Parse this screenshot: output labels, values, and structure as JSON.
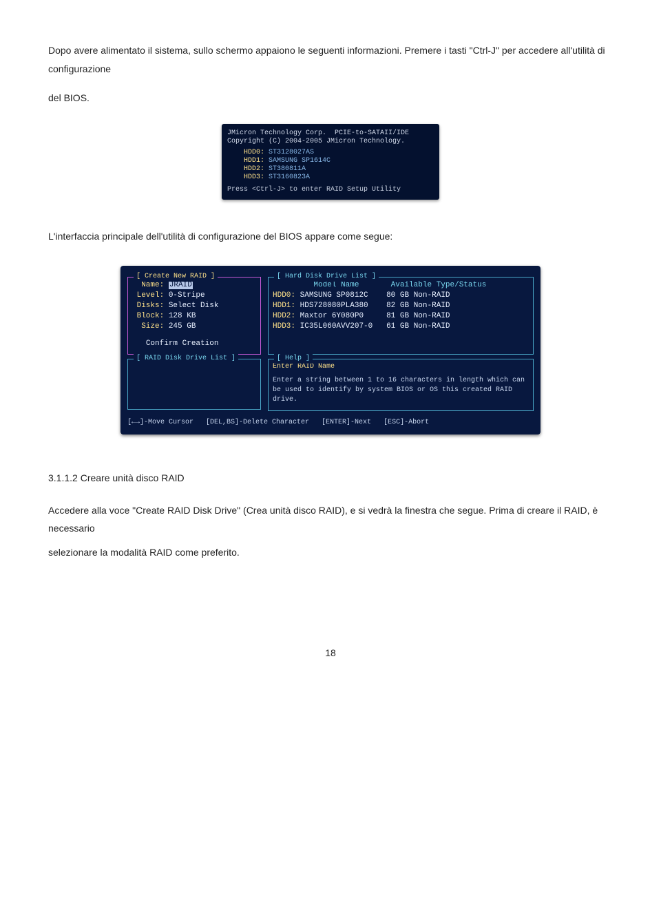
{
  "intro": {
    "line1": "Dopo avere alimentato il sistema, sullo schermo appaiono le seguenti informazioni. Premere i tasti \"Ctrl-J\" per accedere all'utilità di configurazione",
    "line2": "del BIOS."
  },
  "shot1": {
    "hdr1": "JMicron Technology Corp.  PCIE-to-SATAII/IDE",
    "hdr2": "Copyright (C) 2004-2005 JMicron Technology.",
    "hdd0_lbl": "HDD0:",
    "hdd0_val": "ST3128027AS",
    "hdd1_lbl": "HDD1:",
    "hdd1_val": "SAMSUNG SP1614C",
    "hdd2_lbl": "HDD2:",
    "hdd2_val": "ST380811A",
    "hdd3_lbl": "HDD3:",
    "hdd3_val": "ST3160823A",
    "prompt": "Press <Ctrl-J> to enter RAID Setup Utility"
  },
  "mid_para": "L'interfaccia principale dell'utilità di configurazione del BIOS appare come segue:",
  "shot2": {
    "create": {
      "title": "[ Create New RAID ]",
      "name_lbl": "Name:",
      "name_val": "JRAID",
      "level_lbl": "Level:",
      "level_val": "0-Stripe",
      "disks_lbl": "Disks:",
      "disks_val": "Select Disk",
      "block_lbl": "Block:",
      "block_val": "128 KB",
      "size_lbl": "Size:",
      "size_val": "245 GB",
      "confirm": "Confirm Creation"
    },
    "hdd_list": {
      "title": "[ Hard Disk Drive List ]",
      "col_model": "Model Name",
      "col_avail": "Available",
      "col_type": "Type/Status",
      "rows": [
        {
          "id": "HDD0:",
          "model": "SAMSUNG SP0812C",
          "avail": "80 GB",
          "type": "Non-RAID"
        },
        {
          "id": "HDD1:",
          "model": "HDS728080PLA380",
          "avail": "82 GB",
          "type": "Non-RAID"
        },
        {
          "id": "HDD2:",
          "model": "Maxtor 6Y080P0",
          "avail": "81 GB",
          "type": "Non-RAID"
        },
        {
          "id": "HDD3:",
          "model": "IC35L060AVV207-0",
          "avail": "61 GB",
          "type": "Non-RAID"
        }
      ]
    },
    "raid_list_title": "[ RAID Disk Drive List ]",
    "help": {
      "title": "[ Help ]",
      "head": "Enter RAID Name",
      "body": "Enter a string between  1 to 16 characters in length which can be used to identify by system BIOS or OS this created RAID drive."
    },
    "footer": "[←→]-Move Cursor   [DEL,BS]-Delete Character   [ENTER]-Next   [ESC]-Abort"
  },
  "subhead": "3.1.1.2   Creare unità disco RAID",
  "outro": {
    "line1": "Accedere alla voce \"Create RAID Disk Drive\" (Crea unità disco RAID), e si vedrà la finestra che segue. Prima di creare il RAID, è necessario",
    "line2": "selezionare la modalità RAID come preferito."
  },
  "page_number": "18"
}
